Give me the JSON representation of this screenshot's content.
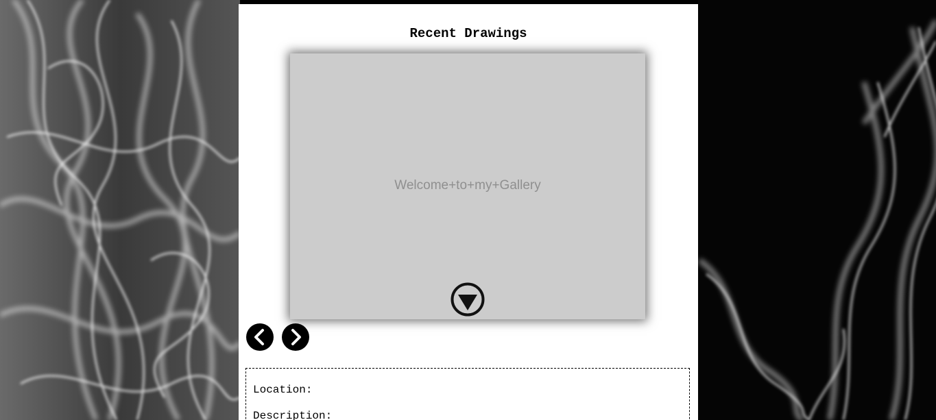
{
  "page": {
    "title": "Recent Drawings"
  },
  "slideshow": {
    "placeholder_text": "Welcome+to+my+Gallery",
    "toggle_icon": "triangle-down-circle-icon",
    "prev_icon": "chevron-left-circle-icon",
    "next_icon": "chevron-right-circle-icon"
  },
  "details": {
    "location_label": "Location:",
    "description_label": "Description:"
  },
  "colors": {
    "panel_bg": "#ffffff",
    "slide_bg": "#cccccc",
    "slide_text": "#8f8f8f",
    "page_bg": "#000000",
    "icon": "#000000"
  }
}
